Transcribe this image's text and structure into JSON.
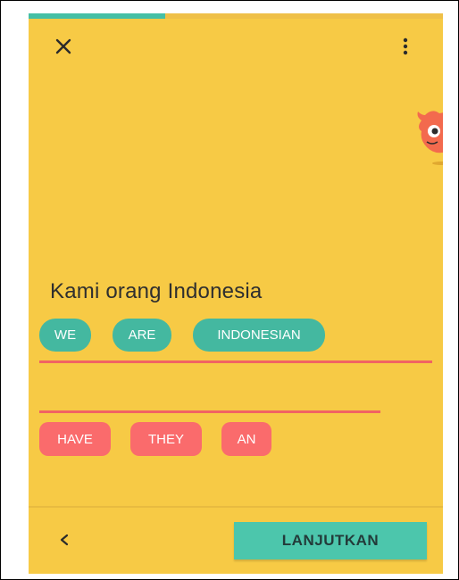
{
  "progress": {
    "fraction": 0.33,
    "fill_color": "#45BFA5"
  },
  "header": {
    "close_icon": "close-icon",
    "more_icon": "more-vertical-icon"
  },
  "mascot": {
    "icon": "monster-mascot"
  },
  "lesson": {
    "prompt": "Kami orang Indonesia",
    "answer_words": [
      "WE",
      "ARE",
      "INDONESIAN"
    ],
    "bank_words": [
      "HAVE",
      "THEY",
      "AN"
    ]
  },
  "footer": {
    "back_label": "<",
    "continue_label": "LANJUTKAN"
  },
  "colors": {
    "background": "#F7CA45",
    "teal": "#44B8A0",
    "coral": "#FA6B6C",
    "line": "#F16363"
  }
}
